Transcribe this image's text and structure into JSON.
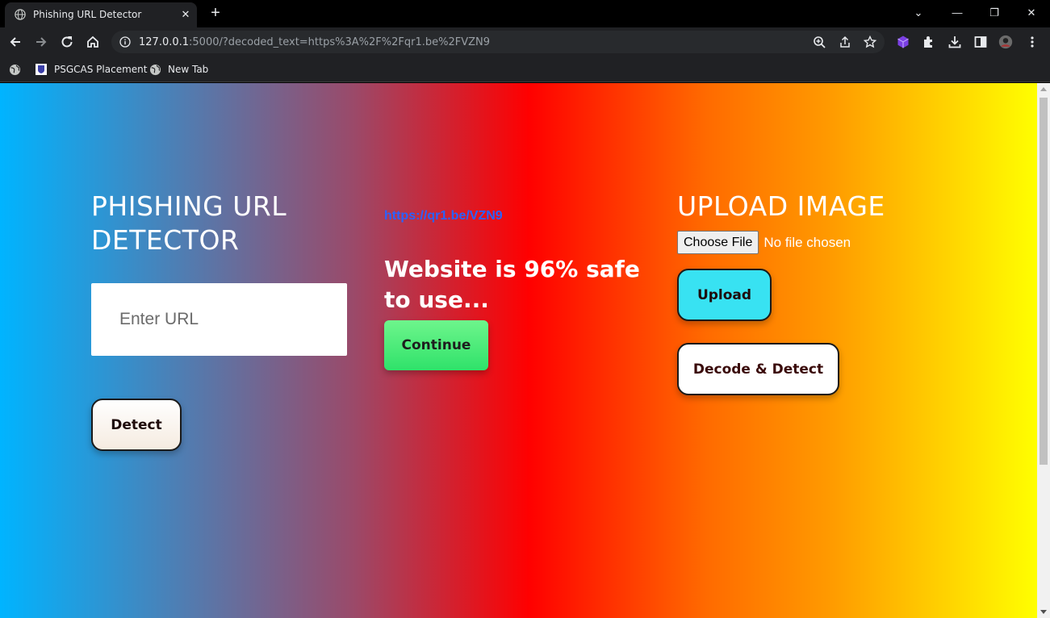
{
  "browser": {
    "tab_title": "Phishing URL Detector",
    "url_host": "127.0.0.1",
    "url_rest": ":5000/?decoded_text=https%3A%2F%2Fqr1.be%2FVZN9",
    "bookmarks": [
      {
        "label": "PSGCAS Placement"
      },
      {
        "label": "New Tab"
      }
    ]
  },
  "page": {
    "detector_title_line1": "PHISHING URL",
    "detector_title_line2": "DETECTOR",
    "url_placeholder": "Enter URL",
    "detect_label": "Detect",
    "decoded_url": "https://qr1.be/VZN9",
    "result_text": "Website is 96% safe to use...",
    "continue_label": "Continue",
    "upload_title": "UPLOAD IMAGE",
    "choose_file_label": "Choose File",
    "no_file_text": "No file chosen",
    "upload_label": "Upload",
    "decode_label": "Decode & Detect"
  },
  "colors": {
    "gradient": [
      "#00b4ff",
      "#9a4a6a",
      "#ff0000",
      "#ff6a00",
      "#ffff00"
    ],
    "upload_button": "#38e2f2",
    "continue_button": "#2fe26a",
    "link": "#2962ff"
  }
}
